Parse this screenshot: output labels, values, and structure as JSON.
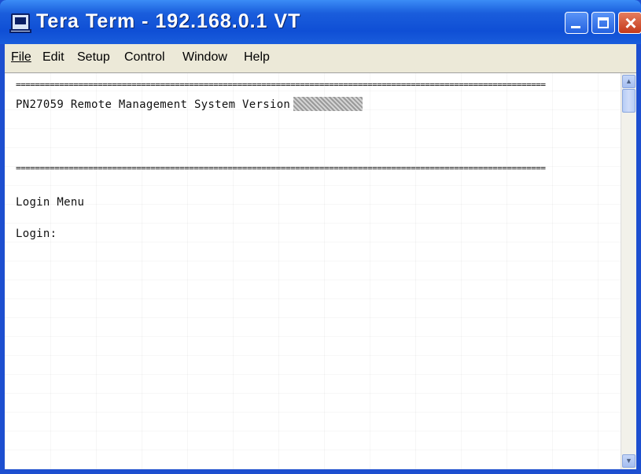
{
  "window": {
    "title": "Tera Term - 192.168.0.1 VT"
  },
  "menubar": {
    "items": [
      {
        "label": "File"
      },
      {
        "label": "Edit"
      },
      {
        "label": "Setup"
      },
      {
        "label": "Control"
      },
      {
        "label": "Window"
      },
      {
        "label": "Help"
      }
    ]
  },
  "terminal": {
    "separator": "==============================================================================================================",
    "header": "PN27059 Remote Management System Version",
    "menu_title": "Login Menu",
    "login_prompt": "Login:"
  },
  "icons": {
    "app": "terminal-icon",
    "minimize": "minimize-icon",
    "maximize": "maximize-icon",
    "close": "close-icon",
    "scroll_up": "arrow-up-icon",
    "scroll_down": "arrow-down-icon"
  },
  "colors": {
    "titlebar": "#1a5ddc",
    "close_button": "#c4391a",
    "menubar": "#ece9d8",
    "terminal_bg": "#ffffff"
  }
}
